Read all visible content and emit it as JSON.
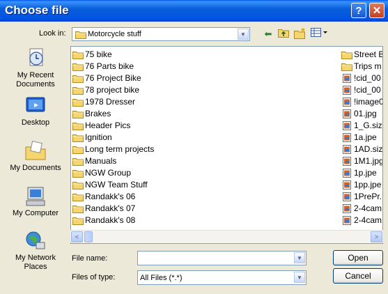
{
  "window": {
    "title": "Choose file",
    "help_glyph": "?",
    "close_glyph": "✕"
  },
  "toolbar": {
    "look_in_label": "Look in:",
    "look_in_value": "Motorcycle stuff",
    "icons": [
      "back-arrow-icon",
      "up-one-level-icon",
      "new-folder-icon",
      "view-menu-icon"
    ]
  },
  "places": [
    {
      "label": "My Recent Documents",
      "icon": "recent-documents-icon"
    },
    {
      "label": "Desktop",
      "icon": "desktop-icon"
    },
    {
      "label": "My Documents",
      "icon": "my-documents-icon"
    },
    {
      "label": "My Computer",
      "icon": "my-computer-icon"
    },
    {
      "label": "My Network Places",
      "icon": "network-places-icon"
    }
  ],
  "folders": [
    "75 bike",
    "76 Parts bike",
    "76 Project Bike",
    "78 project bike",
    "1978 Dresser",
    "Brakes",
    "Header Pics",
    "Ignition",
    "Long term projects",
    "Manuals",
    "NGW Group",
    "NGW Team Stuff",
    "Randakk's 06",
    "Randakk's 07",
    "Randakk's 08"
  ],
  "column2": [
    {
      "name": "Street B",
      "kind": "folder"
    },
    {
      "name": "Trips m",
      "kind": "folder"
    },
    {
      "name": "!cid_00",
      "kind": "image"
    },
    {
      "name": "!cid_00",
      "kind": "image"
    },
    {
      "name": "!image0",
      "kind": "image"
    },
    {
      "name": "01.jpg",
      "kind": "image"
    },
    {
      "name": "1_G.size",
      "kind": "image"
    },
    {
      "name": "1a.jpe",
      "kind": "image"
    },
    {
      "name": "1AD.siz",
      "kind": "image"
    },
    {
      "name": "1M1.jpg",
      "kind": "image"
    },
    {
      "name": "1p.jpe",
      "kind": "image"
    },
    {
      "name": "1pp.jpe",
      "kind": "image"
    },
    {
      "name": "1PrePr.",
      "kind": "image"
    },
    {
      "name": "2-4cam",
      "kind": "image"
    },
    {
      "name": "2-4cam",
      "kind": "image"
    }
  ],
  "scrollbar": {
    "left_arrow": "<",
    "right_arrow": ">"
  },
  "form": {
    "file_name_label": "File name:",
    "file_name_value": "",
    "file_type_label": "Files of type:",
    "file_type_value": "All Files (*.*)"
  },
  "buttons": {
    "open": "Open",
    "cancel": "Cancel"
  },
  "colors": {
    "title_bar": "#0054e3",
    "dialog_bg": "#ece9d8",
    "folder": "#f5d66e",
    "close_button": "#c3411f",
    "input_border": "#7f9db9"
  }
}
